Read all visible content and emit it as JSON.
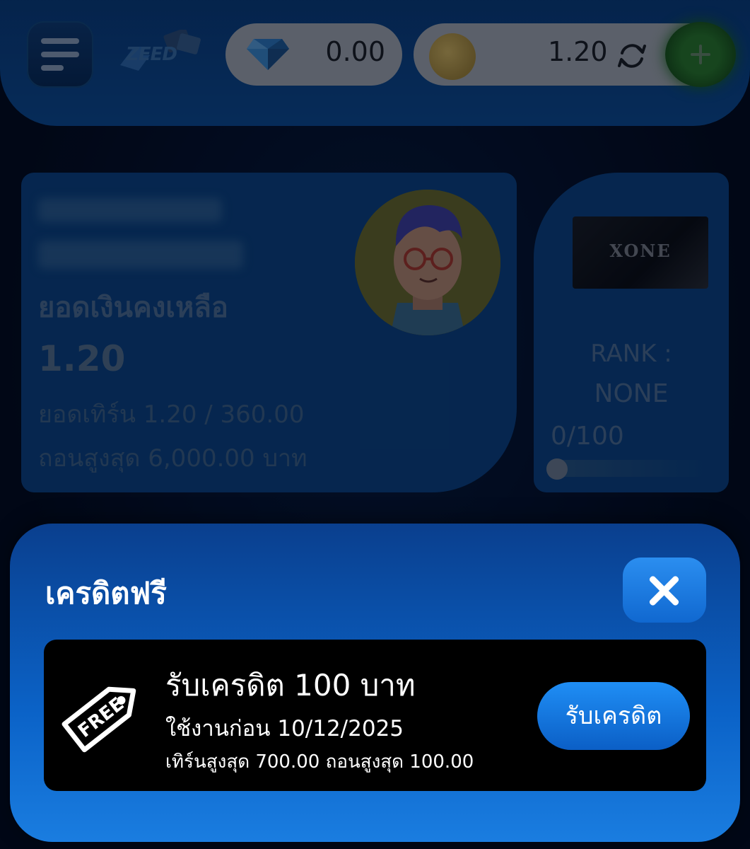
{
  "header": {
    "logo_text": "ZEED",
    "gem_balance": "0.00",
    "coin_balance": "1.20",
    "icons": [
      "menu-icon",
      "diamond-icon",
      "coin-icon",
      "refresh-icon",
      "plus-icon"
    ]
  },
  "balance_card": {
    "label": "ยอดเงินคงเหลือ",
    "value": "1.20",
    "turnover": "ยอดเทิร์น 1.20 / 360.00",
    "max_withdraw": "ถอนสูงสุด 6,000.00 บาท"
  },
  "rank_card": {
    "card_text": "XONE",
    "rank_label": "RANK :",
    "rank_value": "NONE",
    "progress_text": "0/100",
    "progress": 0
  },
  "modal": {
    "title": "เครดิตฟรี",
    "credit": {
      "icon_text": "FREE",
      "title": "รับเครดิต 100 บาท",
      "expire": "ใช้งานก่อน 10/12/2025",
      "limits": "เทิร์นสูงสุด 700.00 ถอนสูงสุด 100.00",
      "claim_label": "รับเครดิต"
    }
  },
  "colors": {
    "primary_blue": "#0b63c8",
    "button_blue": "#1f8ef5",
    "add_green": "#2a7a2a"
  }
}
